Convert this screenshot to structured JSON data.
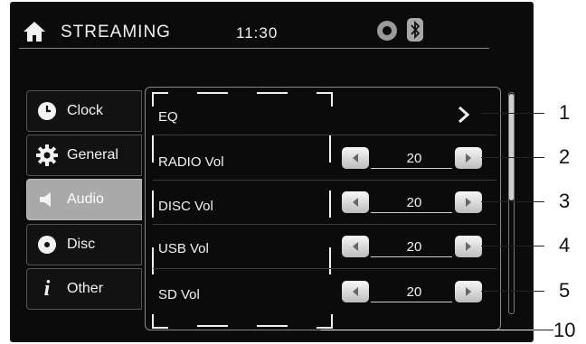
{
  "header": {
    "title": "STREAMING",
    "time": "11:30",
    "icons": [
      "home-icon",
      "disc-status-icon",
      "bluetooth-icon"
    ]
  },
  "sidebar": {
    "items": [
      {
        "label": "Clock",
        "icon": "clock-icon",
        "active": false
      },
      {
        "label": "General",
        "icon": "gear-icon",
        "active": false
      },
      {
        "label": "Audio",
        "icon": "speaker-icon",
        "active": true
      },
      {
        "label": "Disc",
        "icon": "disc-icon",
        "active": false
      },
      {
        "label": "Other",
        "icon": "info-icon",
        "active": false
      }
    ]
  },
  "settings": {
    "eq": {
      "label": "EQ"
    },
    "rows": [
      {
        "label": "RADIO Vol",
        "value": "20"
      },
      {
        "label": "DISC Vol",
        "value": "20"
      },
      {
        "label": "USB Vol",
        "value": "20"
      },
      {
        "label": "SD Vol",
        "value": "20"
      }
    ]
  },
  "callouts": [
    "1",
    "2",
    "3",
    "4",
    "5",
    "10"
  ],
  "colors": {
    "screen_bg": "#0b0b0b",
    "active_tab": "#a9a9a9",
    "text": "#f2f2f2"
  }
}
